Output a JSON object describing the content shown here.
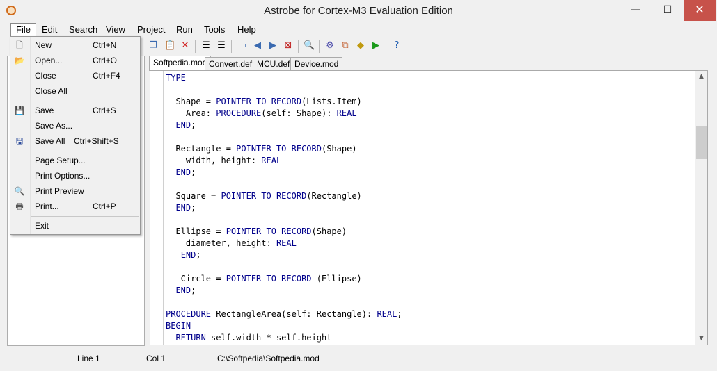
{
  "window": {
    "title": "Astrobe for Cortex-M3 Evaluation Edition",
    "min": "—",
    "max": "☐",
    "close": "✕"
  },
  "menu": [
    "File",
    "Edit",
    "Search",
    "View",
    "Project",
    "Run",
    "Tools",
    "Help"
  ],
  "file_menu": {
    "new": {
      "label": "New",
      "shortcut": "Ctrl+N"
    },
    "open": {
      "label": "Open...",
      "shortcut": "Ctrl+O"
    },
    "close": {
      "label": "Close",
      "shortcut": "Ctrl+F4"
    },
    "close_all": {
      "label": "Close All"
    },
    "save": {
      "label": "Save",
      "shortcut": "Ctrl+S"
    },
    "save_as": {
      "label": "Save As..."
    },
    "save_all": {
      "label": "Save All",
      "shortcut": "Ctrl+Shift+S"
    },
    "page_setup": {
      "label": "Page Setup..."
    },
    "print_options": {
      "label": "Print Options..."
    },
    "print_preview": {
      "label": "Print Preview"
    },
    "print": {
      "label": "Print...",
      "shortcut": "Ctrl+P"
    },
    "exit": {
      "label": "Exit"
    }
  },
  "toolbar_icons": [
    "copy-icon",
    "paste-icon",
    "cut-icon",
    "indent-icon",
    "outdent-icon",
    "window-icon",
    "back-icon",
    "forward-icon",
    "stop-icon",
    "find-icon",
    "build-icon",
    "link-icon",
    "tag-icon",
    "run-icon",
    "help-icon"
  ],
  "tabs": [
    "Softpedia.mod",
    "Convert.def",
    "MCU.def",
    "Device.mod"
  ],
  "code": [
    {
      "k": "TYPE",
      "r": ""
    },
    {
      "k": "",
      "r": ""
    },
    {
      "parts": [
        "  Shape = ",
        "#POINTER TO RECORD",
        "(Lists.Item)"
      ]
    },
    {
      "parts": [
        "    Area: ",
        "#PROCEDURE",
        "(self: Shape): ",
        "#REAL"
      ]
    },
    {
      "parts": [
        "  ",
        "#END",
        ";"
      ]
    },
    {
      "parts": [
        ""
      ]
    },
    {
      "parts": [
        "  Rectangle = ",
        "#POINTER TO RECORD",
        "(Shape)"
      ]
    },
    {
      "parts": [
        "    width, height: ",
        "#REAL"
      ]
    },
    {
      "parts": [
        "  ",
        "#END",
        ";"
      ]
    },
    {
      "parts": [
        ""
      ]
    },
    {
      "parts": [
        "  Square = ",
        "#POINTER TO RECORD",
        "(Rectangle)"
      ]
    },
    {
      "parts": [
        "  ",
        "#END",
        ";"
      ]
    },
    {
      "parts": [
        ""
      ]
    },
    {
      "parts": [
        "  Ellipse = ",
        "#POINTER TO RECORD",
        "(Shape)"
      ]
    },
    {
      "parts": [
        "    diameter, height: ",
        "#REAL"
      ]
    },
    {
      "parts": [
        "   ",
        "#END",
        ";"
      ]
    },
    {
      "parts": [
        ""
      ]
    },
    {
      "parts": [
        "   Circle = ",
        "#POINTER TO RECORD",
        " (Ellipse)"
      ]
    },
    {
      "parts": [
        "  ",
        "#END",
        ";"
      ]
    },
    {
      "parts": [
        ""
      ]
    },
    {
      "parts": [
        "#PROCEDURE",
        " RectangleArea(self: Rectangle): ",
        "#REAL",
        ";"
      ]
    },
    {
      "parts": [
        "#BEGIN"
      ]
    },
    {
      "parts": [
        "  ",
        "#RETURN",
        " self.width * self.height"
      ]
    }
  ],
  "status": {
    "line": "Line 1",
    "col": "Col 1",
    "path": "C:\\Softpedia\\Softpedia.mod"
  }
}
